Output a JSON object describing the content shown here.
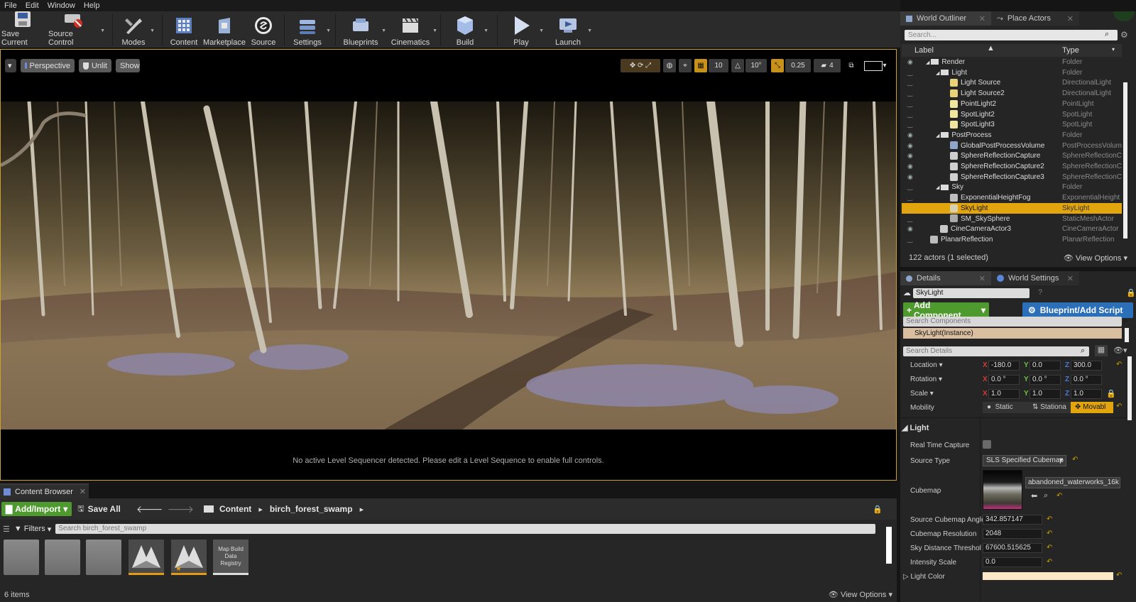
{
  "menu": [
    "File",
    "Edit",
    "Window",
    "Help"
  ],
  "toolbar": [
    {
      "label": "Save Current",
      "icon": "save-icon"
    },
    {
      "label": "Source Control",
      "icon": "source-control-icon"
    },
    {
      "label": "Modes",
      "icon": "modes-icon"
    },
    {
      "label": "Content",
      "icon": "content-icon"
    },
    {
      "label": "Marketplace",
      "icon": "marketplace-icon"
    },
    {
      "label": "Source",
      "icon": "source-icon"
    },
    {
      "label": "Settings",
      "icon": "settings-icon"
    },
    {
      "label": "Blueprints",
      "icon": "blueprints-icon"
    },
    {
      "label": "Cinematics",
      "icon": "cinematics-icon"
    },
    {
      "label": "Build",
      "icon": "build-icon"
    },
    {
      "label": "Play",
      "icon": "play-icon"
    },
    {
      "label": "Launch",
      "icon": "launch-icon"
    }
  ],
  "viewport": {
    "perspective": "Perspective",
    "lighting": "Unlit",
    "show": "Show",
    "grid_snap": "10",
    "rot_snap": "10°",
    "scale_snap": "0.25",
    "cam_speed": "4",
    "sequencer_msg": "No active Level Sequencer detected. Please edit a Level Sequence to enable full controls."
  },
  "outliner": {
    "tab1": "World Outliner",
    "tab2": "Place Actors",
    "search_placeholder": "Search...",
    "col_label": "Label",
    "col_type": "Type",
    "rows": [
      {
        "label": "Render",
        "type": "Folder"
      },
      {
        "label": "Light",
        "type": "Folder"
      },
      {
        "label": "Light Source",
        "type": "DirectionalLight"
      },
      {
        "label": "Light Source2",
        "type": "DirectionalLight"
      },
      {
        "label": "PointLight2",
        "type": "PointLight"
      },
      {
        "label": "SpotLight2",
        "type": "SpotLight"
      },
      {
        "label": "SpotLight3",
        "type": "SpotLight"
      },
      {
        "label": "PostProcess",
        "type": "Folder"
      },
      {
        "label": "GlobalPostProcessVolume",
        "type": "PostProcessVolum"
      },
      {
        "label": "SphereReflectionCapture",
        "type": "SphereReflectionC"
      },
      {
        "label": "SphereReflectionCapture2",
        "type": "SphereReflectionC"
      },
      {
        "label": "SphereReflectionCapture3",
        "type": "SphereReflectionC"
      },
      {
        "label": "Sky",
        "type": "Folder"
      },
      {
        "label": "ExponentialHeightFog",
        "type": "ExponentialHeight"
      },
      {
        "label": "SkyLight",
        "type": "SkyLight"
      },
      {
        "label": "SM_SkySphere",
        "type": "StaticMeshActor"
      },
      {
        "label": "CineCameraActor3",
        "type": "CineCameraActor"
      },
      {
        "label": "PlanarReflection",
        "type": "PlanarReflection"
      }
    ],
    "count": "122 actors (1 selected)",
    "view_options": "View Options"
  },
  "details": {
    "tab1": "Details",
    "tab2": "World Settings",
    "name": "SkyLight",
    "add_component": "Add Component",
    "blueprint": "Blueprint/Add Script",
    "search_components": "Search Components",
    "instance": "SkyLight(Instance)",
    "search_details": "Search Details",
    "location_label": "Location",
    "loc_x": "-180.0",
    "loc_y": "0.0",
    "loc_z": "300.0",
    "rotation_label": "Rotation",
    "rot_x": "0.0 °",
    "rot_y": "0.0 °",
    "rot_z": "0.0 °",
    "scale_label": "Scale",
    "scale_x": "1.0",
    "scale_y": "1.0",
    "scale_z": "1.0",
    "mobility_label": "Mobility",
    "mob_static": "Static",
    "mob_stationary": "Stationa",
    "mob_movable": "Movabl",
    "light_section": "Light",
    "real_time_capture": "Real Time Capture",
    "source_type_label": "Source Type",
    "source_type": "SLS Specified Cubemap",
    "cubemap_label": "Cubemap",
    "cubemap": "abandoned_waterworks_16k",
    "angle_label": "Source Cubemap Angle",
    "angle": "342.857147",
    "res_label": "Cubemap Resolution",
    "res": "2048",
    "thresh_label": "Sky Distance Threshol",
    "thresh": "67600.515625",
    "intensity_label": "Intensity Scale",
    "intensity": "0.0",
    "color_label": "Light Color"
  },
  "content_browser": {
    "tab": "Content Browser",
    "add_import": "Add/Import",
    "save_all": "Save All",
    "crumb1": "Content",
    "crumb2": "birch_forest_swamp",
    "filters": "Filters",
    "search_placeholder": "Search birch_forest_swamp",
    "registry_label": "Map Build Data Registry",
    "items": "6 items",
    "view_options": "View Options"
  },
  "colors": {
    "accent": "#e2a50e",
    "add_green": "#4f9a2e",
    "blueprint_blue": "#2a6fb8"
  }
}
